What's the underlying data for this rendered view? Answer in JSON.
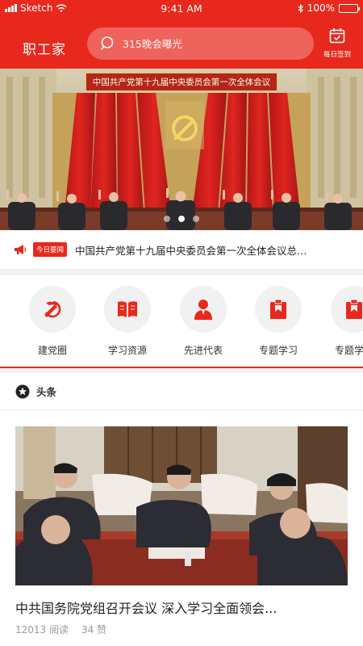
{
  "status_bar": {
    "carrier": "Sketch",
    "time": "9:41 AM",
    "battery": "100%"
  },
  "header": {
    "title": "职工家",
    "search_placeholder": "315晚会曝光",
    "checkin_label": "每日签到"
  },
  "hero": {
    "caption": "中国共产党第十九届中央委员会第一次全体会议",
    "active_slide": 1,
    "slide_count": 3
  },
  "ticker": {
    "badge": "今日要闻",
    "text": "中国共产党第十九届中央委员会第一次全体会议总结..."
  },
  "categories": [
    {
      "label": "建党圈",
      "icon": "hammer-sickle-icon"
    },
    {
      "label": "学习资源",
      "icon": "book-icon"
    },
    {
      "label": "先进代表",
      "icon": "person-icon"
    },
    {
      "label": "专题学习",
      "icon": "clipboard-icon"
    },
    {
      "label": "专题学习",
      "icon": "clipboard-icon"
    }
  ],
  "news": {
    "section_label": "头条",
    "section_icon": "star-icon",
    "article": {
      "title": "中共国务院党组召开会议 深入学习全面领会...",
      "reads": "12013 阅读",
      "likes": "34 赞"
    }
  },
  "colors": {
    "brand_red": "#e8281c",
    "muted_text": "#999999"
  }
}
